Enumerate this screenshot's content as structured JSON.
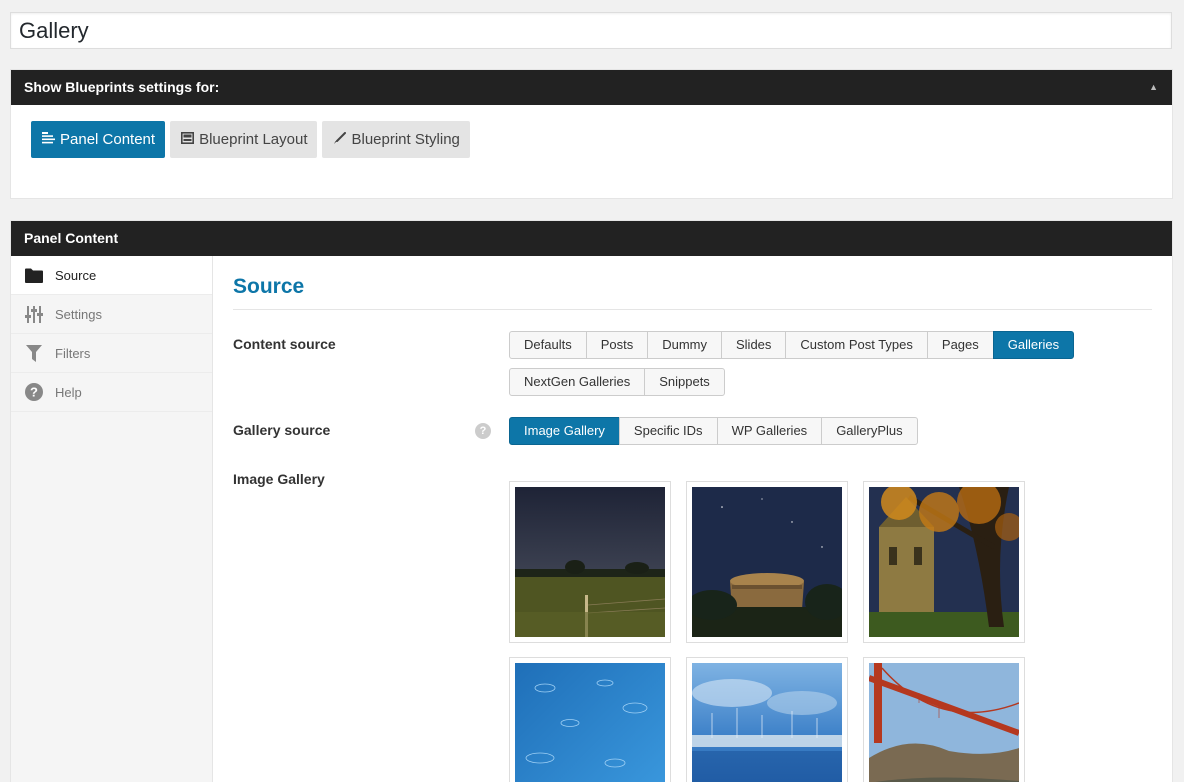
{
  "page": {
    "title_value": "Gallery"
  },
  "blueprints": {
    "header": "Show Blueprints settings for:",
    "buttons": [
      {
        "label": "Panel Content",
        "icon": "align-left-icon"
      },
      {
        "label": "Blueprint Layout",
        "icon": "layout-icon"
      },
      {
        "label": "Blueprint Styling",
        "icon": "brush-icon"
      }
    ]
  },
  "panel_content": {
    "header": "Panel Content",
    "sidebar": [
      {
        "label": "Source",
        "icon": "folder-icon"
      },
      {
        "label": "Settings",
        "icon": "sliders-icon"
      },
      {
        "label": "Filters",
        "icon": "filter-icon"
      },
      {
        "label": "Help",
        "icon": "help-icon"
      }
    ],
    "section_title": "Source",
    "content_source": {
      "label": "Content source",
      "options": [
        "Defaults",
        "Posts",
        "Dummy",
        "Slides",
        "Custom Post Types",
        "Pages",
        "Galleries",
        "NextGen Galleries",
        "Snippets"
      ],
      "selected": "Galleries"
    },
    "gallery_source": {
      "label": "Gallery source",
      "help": "?",
      "options": [
        "Image Gallery",
        "Specific IDs",
        "WP Galleries",
        "GalleryPlus"
      ],
      "selected": "Image Gallery"
    },
    "image_gallery": {
      "label": "Image Gallery",
      "images": [
        "night-field-image",
        "night-tower-image",
        "autumn-castle-image",
        "rain-water-image",
        "harbor-boats-image",
        "golden-gate-bridge-image"
      ]
    }
  }
}
